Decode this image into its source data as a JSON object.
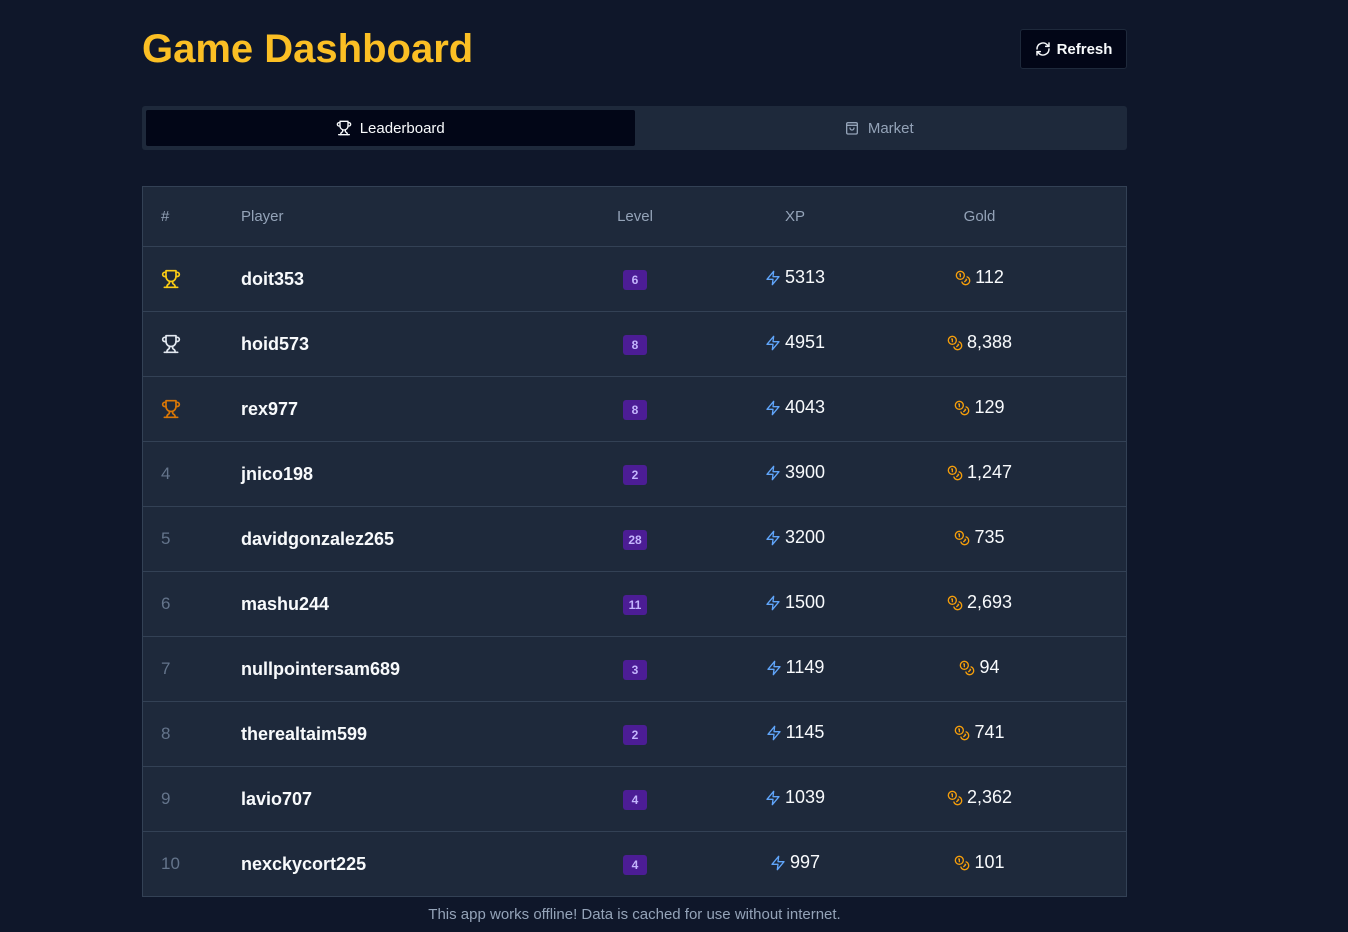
{
  "header": {
    "title": "Game Dashboard",
    "refresh_label": "Refresh"
  },
  "tabs": [
    {
      "label": "Leaderboard",
      "icon": "trophy-icon",
      "active": true
    },
    {
      "label": "Market",
      "icon": "shopping-bag-icon",
      "active": false
    }
  ],
  "table": {
    "columns": [
      "#",
      "Player",
      "Level",
      "XP",
      "Gold"
    ],
    "rows": [
      {
        "rank": "1",
        "trophy": "gold",
        "player": "doit353",
        "level": "6",
        "xp": "5313",
        "gold": "112"
      },
      {
        "rank": "2",
        "trophy": "silver",
        "player": "hoid573",
        "level": "8",
        "xp": "4951",
        "gold": "8,388"
      },
      {
        "rank": "3",
        "trophy": "bronze",
        "player": "rex977",
        "level": "8",
        "xp": "4043",
        "gold": "129"
      },
      {
        "rank": "4",
        "player": "jnico198",
        "level": "2",
        "xp": "3900",
        "gold": "1,247"
      },
      {
        "rank": "5",
        "player": "davidgonzalez265",
        "level": "28",
        "xp": "3200",
        "gold": "735"
      },
      {
        "rank": "6",
        "player": "mashu244",
        "level": "11",
        "xp": "1500",
        "gold": "2,693"
      },
      {
        "rank": "7",
        "player": "nullpointersam689",
        "level": "3",
        "xp": "1149",
        "gold": "94"
      },
      {
        "rank": "8",
        "player": "therealtaim599",
        "level": "2",
        "xp": "1145",
        "gold": "741"
      },
      {
        "rank": "9",
        "player": "lavio707",
        "level": "4",
        "xp": "1039",
        "gold": "2,362"
      },
      {
        "rank": "10",
        "player": "nexckycort225",
        "level": "4",
        "xp": "997",
        "gold": "101"
      }
    ]
  },
  "colors": {
    "accent": "#fbbf24",
    "trophy_gold": "#facc15",
    "trophy_silver": "#e2e8f0",
    "trophy_bronze": "#d97706",
    "xp_icon": "#60a5fa",
    "gold_icon": "#f59e0b"
  },
  "footer": {
    "text": "This app works offline! Data is cached for use without internet."
  }
}
